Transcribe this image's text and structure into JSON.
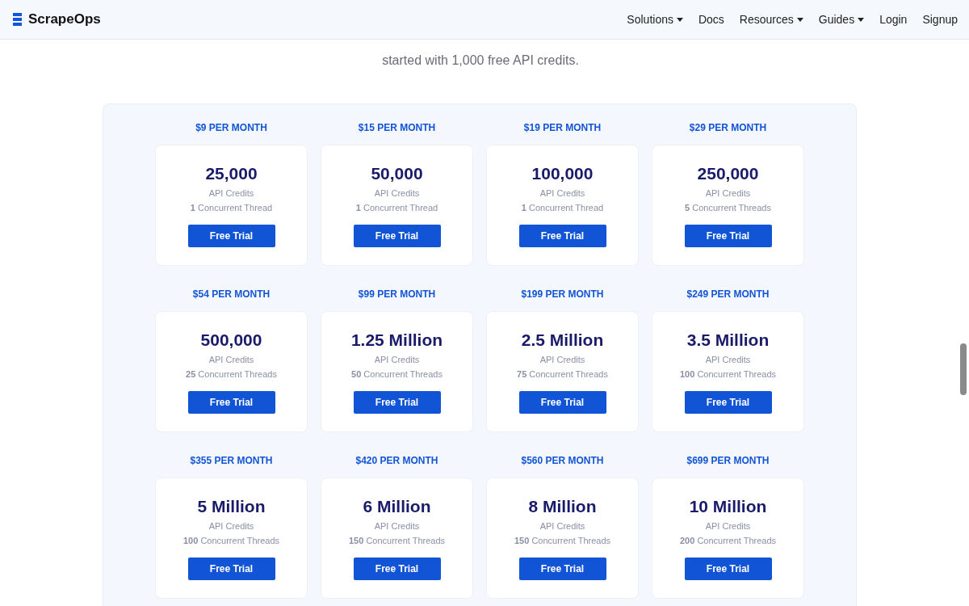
{
  "header": {
    "logo": "ScrapeOps",
    "nav": [
      {
        "label": "Solutions",
        "dropdown": true
      },
      {
        "label": "Docs",
        "dropdown": false
      },
      {
        "label": "Resources",
        "dropdown": true
      },
      {
        "label": "Guides",
        "dropdown": true
      },
      {
        "label": "Login",
        "dropdown": false
      },
      {
        "label": "Signup",
        "dropdown": false
      }
    ]
  },
  "intro": "started with 1,000 free API credits.",
  "plans": [
    {
      "price": "$9 PER MONTH",
      "credits": "25,000",
      "credits_label": "API Credits",
      "threads": "**1** Concurrent Thread",
      "button": "Free Trial"
    },
    {
      "price": "$15 PER MONTH",
      "credits": "50,000",
      "credits_label": "API Credits",
      "threads": "**1** Concurrent Thread",
      "button": "Free Trial"
    },
    {
      "price": "$19 PER MONTH",
      "credits": "100,000",
      "credits_label": "API Credits",
      "threads": "**1** Concurrent Thread",
      "button": "Free Trial"
    },
    {
      "price": "$29 PER MONTH",
      "credits": "250,000",
      "credits_label": "API Credits",
      "threads": "**5** Concurrent Threads",
      "button": "Free Trial"
    },
    {
      "price": "$54 PER MONTH",
      "credits": "500,000",
      "credits_label": "API Credits",
      "threads": "**25** Concurrent Threads",
      "button": "Free Trial"
    },
    {
      "price": "$99 PER MONTH",
      "credits": "1.25 Million",
      "credits_label": "API Credits",
      "threads": "**50** Concurrent Threads",
      "button": "Free Trial"
    },
    {
      "price": "$199 PER MONTH",
      "credits": "2.5 Million",
      "credits_label": "API Credits",
      "threads": "**75** Concurrent Threads",
      "button": "Free Trial"
    },
    {
      "price": "$249 PER MONTH",
      "credits": "3.5 Million",
      "credits_label": "API Credits",
      "threads": "**100** Concurrent Threads",
      "button": "Free Trial"
    },
    {
      "price": "$355 PER MONTH",
      "credits": "5 Million",
      "credits_label": "API Credits",
      "threads": "**100** Concurrent Threads",
      "button": "Free Trial"
    },
    {
      "price": "$420 PER MONTH",
      "credits": "6 Million",
      "credits_label": "API Credits",
      "threads": "**150** Concurrent Threads",
      "button": "Free Trial"
    },
    {
      "price": "$560 PER MONTH",
      "credits": "8 Million",
      "credits_label": "API Credits",
      "threads": "**150** Concurrent Threads",
      "button": "Free Trial"
    },
    {
      "price": "$699 PER MONTH",
      "credits": "10 Million",
      "credits_label": "API Credits",
      "threads": "**200** Concurrent Threads",
      "button": "Free Trial"
    }
  ]
}
